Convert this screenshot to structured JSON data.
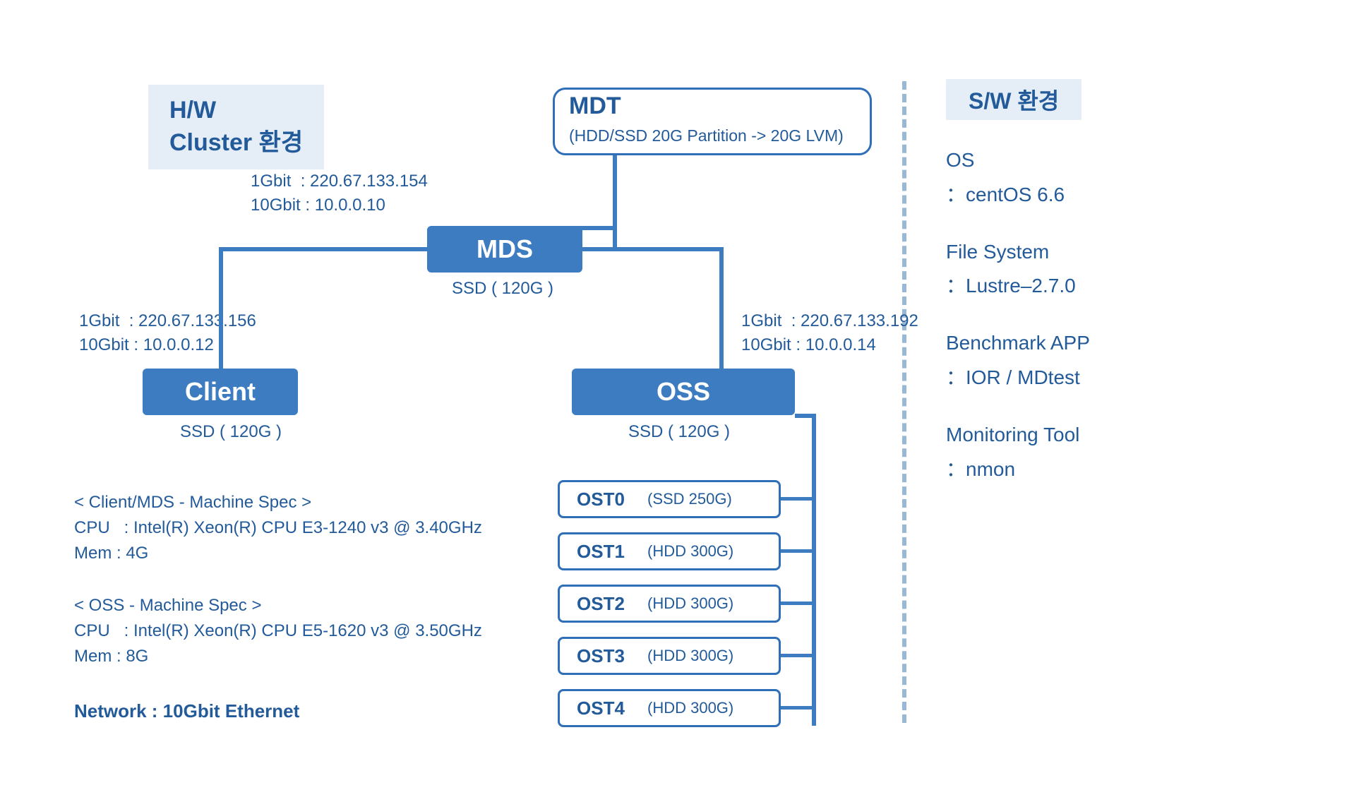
{
  "title": {
    "line1": "H/W",
    "line2": "Cluster 환경"
  },
  "sw_title": "S/W 환경",
  "sw": {
    "os_h": "OS",
    "os_v": "：centOS 6.6",
    "fs_h": "File System",
    "fs_v": "：Lustre–2.7.0",
    "app_h": "Benchmark APP",
    "app_v": "：IOR  /  MDtest",
    "mon_h": "Monitoring Tool",
    "mon_v": "：nmon"
  },
  "mdt": {
    "title": "MDT",
    "sub": "(HDD/SSD 20G Partition -> 20G LVM)"
  },
  "mds": {
    "label": "MDS",
    "storage": "SSD ( 120G )",
    "net": "1Gbit  : 220.67.133.154\n10Gbit : 10.0.0.10"
  },
  "client": {
    "label": "Client",
    "storage": "SSD ( 120G )",
    "net": "1Gbit  : 220.67.133.156\n10Gbit : 10.0.0.12"
  },
  "oss": {
    "label": "OSS",
    "storage": "SSD ( 120G )",
    "net": "1Gbit  : 220.67.133.192\n10Gbit : 10.0.0.14"
  },
  "ost": [
    {
      "name": "OST0",
      "spec": "(SSD 250G)"
    },
    {
      "name": "OST1",
      "spec": "(HDD 300G)"
    },
    {
      "name": "OST2",
      "spec": "(HDD 300G)"
    },
    {
      "name": "OST3",
      "spec": "(HDD 300G)"
    },
    {
      "name": "OST4",
      "spec": "(HDD 300G)"
    }
  ],
  "spec_client_mds": "< Client/MDS - Machine Spec >\nCPU   : Intel(R) Xeon(R) CPU E3-1240 v3 @ 3.40GHz\nMem : 4G",
  "spec_oss": "< OSS - Machine Spec >\nCPU   : Intel(R) Xeon(R) CPU E5-1620 v3 @ 3.50GHz\nMem : 8G",
  "network": "Network : 10Gbit Ethernet"
}
